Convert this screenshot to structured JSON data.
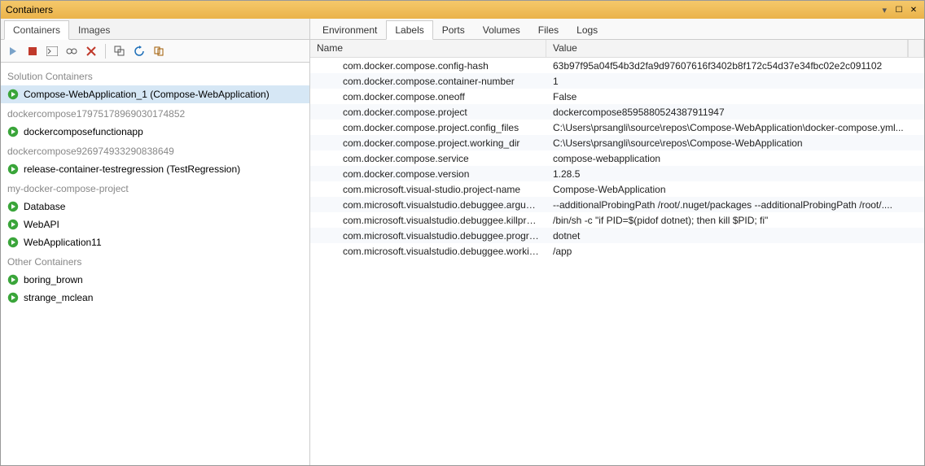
{
  "window": {
    "title": "Containers"
  },
  "sidebar": {
    "viewTabs": [
      {
        "label": "Containers",
        "active": true
      },
      {
        "label": "Images",
        "active": false
      }
    ],
    "groups": [
      {
        "label": "Solution Containers",
        "items": [
          {
            "label": "Compose-WebApplication_1 (Compose-WebApplication)",
            "selected": true
          }
        ]
      },
      {
        "label": "dockercompose17975178969030174852",
        "items": [
          {
            "label": "dockercomposefunctionapp"
          }
        ]
      },
      {
        "label": "dockercompose926974933290838649",
        "items": [
          {
            "label": "release-container-testregression (TestRegression)"
          }
        ]
      },
      {
        "label": "my-docker-compose-project",
        "items": [
          {
            "label": "Database"
          },
          {
            "label": "WebAPI"
          },
          {
            "label": "WebApplication11"
          }
        ]
      },
      {
        "label": "Other Containers",
        "items": [
          {
            "label": "boring_brown"
          },
          {
            "label": "strange_mclean"
          }
        ]
      }
    ]
  },
  "content": {
    "tabs": [
      {
        "label": "Environment"
      },
      {
        "label": "Labels",
        "active": true
      },
      {
        "label": "Ports"
      },
      {
        "label": "Volumes"
      },
      {
        "label": "Files"
      },
      {
        "label": "Logs"
      }
    ],
    "columns": {
      "name": "Name",
      "value": "Value"
    },
    "rows": [
      {
        "name": "com.docker.compose.config-hash",
        "value": "63b97f95a04f54b3d2fa9d97607616f3402b8f172c54d37e34fbc02e2c091102"
      },
      {
        "name": "com.docker.compose.container-number",
        "value": "1"
      },
      {
        "name": "com.docker.compose.oneoff",
        "value": "False"
      },
      {
        "name": "com.docker.compose.project",
        "value": "dockercompose8595880524387911947"
      },
      {
        "name": "com.docker.compose.project.config_files",
        "value": "C:\\Users\\prsangli\\source\\repos\\Compose-WebApplication\\docker-compose.yml..."
      },
      {
        "name": "com.docker.compose.project.working_dir",
        "value": "C:\\Users\\prsangli\\source\\repos\\Compose-WebApplication"
      },
      {
        "name": "com.docker.compose.service",
        "value": "compose-webapplication"
      },
      {
        "name": "com.docker.compose.version",
        "value": "1.28.5"
      },
      {
        "name": "com.microsoft.visual-studio.project-name",
        "value": "Compose-WebApplication"
      },
      {
        "name": "com.microsoft.visualstudio.debuggee.arguments",
        "value": " --additionalProbingPath /root/.nuget/packages --additionalProbingPath /root/...."
      },
      {
        "name": "com.microsoft.visualstudio.debuggee.killprogram",
        "value": "/bin/sh -c \"if PID=$(pidof dotnet); then kill $PID; fi\""
      },
      {
        "name": "com.microsoft.visualstudio.debuggee.program",
        "value": "dotnet"
      },
      {
        "name": "com.microsoft.visualstudio.debuggee.workingdire...",
        "value": "/app"
      }
    ]
  }
}
